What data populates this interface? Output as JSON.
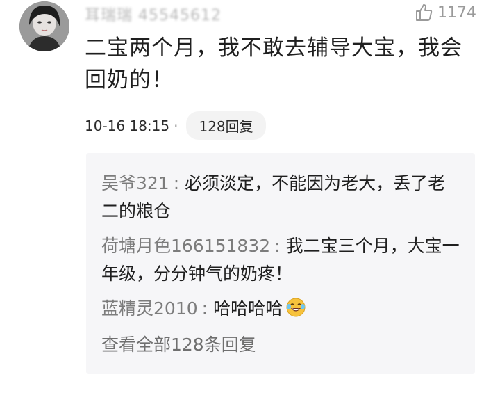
{
  "comment": {
    "username": "耳瑞瑞 45545612",
    "like_count": "1174",
    "text": "二宝两个月，我不敢去辅导大宝，我会回奶的！",
    "timestamp": "10-16 18:15",
    "separator": "·",
    "reply_button": "128回复"
  },
  "replies": [
    {
      "name": "吴爷321",
      "text": "必须淡定，不能因为老大，丢了老二的粮仓"
    },
    {
      "name": "荷塘月色166151832",
      "text": "我二宝三个月，大宝一年级，分分钟气的奶疼！"
    },
    {
      "name": "蓝精灵2010",
      "text": "哈哈哈哈",
      "emoji": "laughing-crying-emoji"
    }
  ],
  "view_all": "查看全部128条回复",
  "icons": {
    "like": "thumbs-up-icon"
  }
}
